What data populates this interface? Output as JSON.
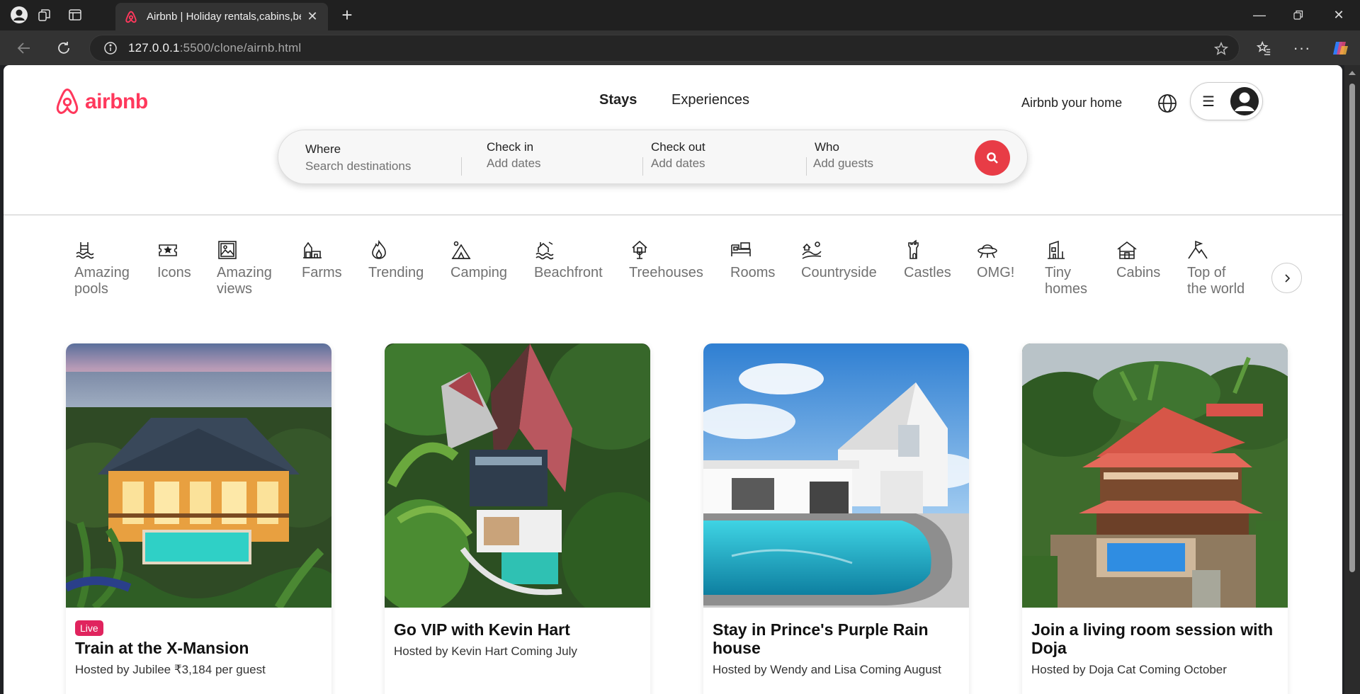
{
  "browser": {
    "tab_title": "Airbnb | Holiday rentals,cabins,beach houses",
    "url_host": "127.0.0.1",
    "url_path": ":5500/clone/airnb.html"
  },
  "header": {
    "logo_text": "airbnb",
    "tabs": [
      "Stays",
      "Experiences"
    ],
    "host_link": "Airbnb your home"
  },
  "search": {
    "where_label": "Where",
    "where_placeholder": "Search destinations",
    "checkin_label": "Check in",
    "checkin_placeholder": "Add dates",
    "checkout_label": "Check out",
    "checkout_placeholder": "Add dates",
    "who_label": "Who",
    "who_placeholder": "Add guests"
  },
  "categories": [
    {
      "line1": "Amazing",
      "line2": "pools",
      "icon": "pool-icon"
    },
    {
      "line1": "Icons",
      "line2": "",
      "icon": "ticket-icon"
    },
    {
      "line1": "Amazing",
      "line2": "views",
      "icon": "picture-icon"
    },
    {
      "line1": "Farms",
      "line2": "",
      "icon": "barn-icon"
    },
    {
      "line1": "Trending",
      "line2": "",
      "icon": "flame-icon"
    },
    {
      "line1": "Camping",
      "line2": "",
      "icon": "tent-icon"
    },
    {
      "line1": "Beachfront",
      "line2": "",
      "icon": "beach-icon"
    },
    {
      "line1": "Treehouses",
      "line2": "",
      "icon": "treehouse-icon"
    },
    {
      "line1": "Rooms",
      "line2": "",
      "icon": "bed-icon"
    },
    {
      "line1": "Countryside",
      "line2": "",
      "icon": "countryside-icon"
    },
    {
      "line1": "Castles",
      "line2": "",
      "icon": "castle-icon"
    },
    {
      "line1": "OMG!",
      "line2": "",
      "icon": "ufo-icon"
    },
    {
      "line1": "Tiny",
      "line2": "homes",
      "icon": "tiny-home-icon"
    },
    {
      "line1": "Cabins",
      "line2": "",
      "icon": "cabin-icon"
    },
    {
      "line1": "Top of",
      "line2": "the world",
      "icon": "summit-flag-icon"
    }
  ],
  "cards": [
    {
      "badge": "Live",
      "title": "Train at the X-Mansion",
      "subtitle": "Hosted by Jubilee ₹3,184 per guest"
    },
    {
      "badge": "",
      "title": "Go VIP with Kevin Hart",
      "subtitle": "Hosted by Kevin Hart Coming July"
    },
    {
      "badge": "",
      "title": "Stay in Prince's Purple Rain house",
      "subtitle": "Hosted by Wendy and Lisa Coming August"
    },
    {
      "badge": "",
      "title": "Join a living room session with Doja",
      "subtitle": "Hosted by Doja Cat Coming October"
    }
  ],
  "colors": {
    "brand": "#FF385C",
    "search_button": "#E83C46",
    "badge": "#E0245E"
  }
}
